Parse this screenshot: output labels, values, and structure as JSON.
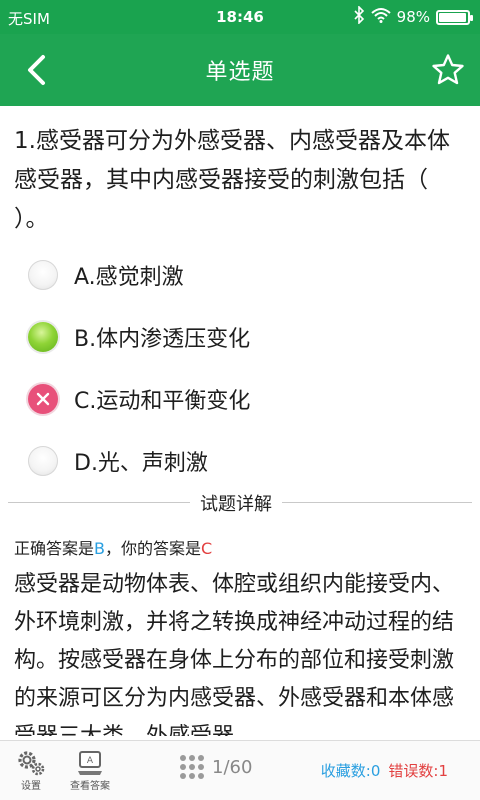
{
  "status": {
    "carrier": "无SIM",
    "time": "18:46",
    "battery": "98%",
    "battery_level": 0.98
  },
  "header": {
    "title": "单选题"
  },
  "question": {
    "text": "1.感受器可分为外感受器、内感受器及本体感受器，其中内感受器接受的刺激包括（ ）。"
  },
  "options": [
    {
      "label": "A.感觉刺激",
      "state": "unselected"
    },
    {
      "label": "B.体内渗透压变化",
      "state": "correct"
    },
    {
      "label": "C.运动和平衡变化",
      "state": "wrong"
    },
    {
      "label": "D.光、声刺激",
      "state": "unselected"
    }
  ],
  "detail": {
    "section_title": "试题详解",
    "correct_prefix": "正确答案是",
    "correct_answer": "B",
    "mine_prefix": "，你的答案是",
    "my_answer": "C",
    "explanation": "感受器是动物体表、体腔或组织内能接受内、外环境刺激，并将之转换成神经冲动过程的结构。按感受器在身体上分布的部位和接受刺激的来源可区分为内感受器、外感受器和本体感受器三大类。外感受器"
  },
  "bottom": {
    "settings_label": "设置",
    "view_answer_label": "查看答案",
    "pager": "1/60",
    "favorites": "收藏数:0",
    "errors": "错误数:1"
  },
  "colors": {
    "brand_green": "#1fa553",
    "correct_answer_blue": "#2a9fe0",
    "wrong_red": "#e24040",
    "wrong_pink": "#e8507a"
  }
}
